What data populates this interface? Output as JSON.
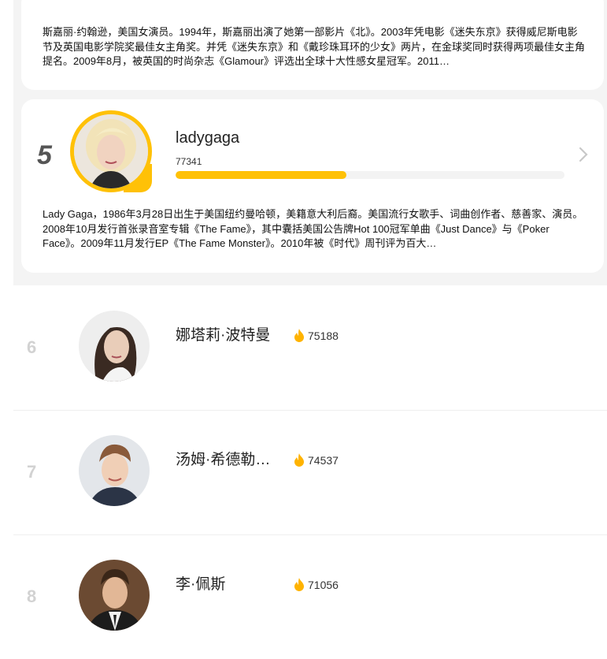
{
  "top_card": {
    "bio": "斯嘉丽·约翰逊，美国女演员。1994年，斯嘉丽出演了她第一部影片《北》。2003年凭电影《迷失东京》获得威尼斯电影节及英国电影学院奖最佳女主角奖。并凭《迷失东京》和《戴珍珠耳环的少女》两片，在金球奖同时获得两项最佳女主角提名。2009年8月，被英国的时尚杂志《Glamour》评选出全球十大性感女星冠军。2011…"
  },
  "featured": {
    "rank": "5",
    "name": "ladygaga",
    "score": "77341",
    "progress": 0.44,
    "bio": "Lady Gaga，1986年3月28日出生于美国纽约曼哈顿，美籍意大利后裔。美国流行女歌手、词曲创作者、慈善家、演员。 2008年10月发行首张录音室专辑《The Fame》，其中囊括美国公告牌Hot 100冠军单曲《Just Dance》与《Poker Face》。2009年11月发行EP《The Fame Monster》。2010年被《时代》周刊评为百大…"
  },
  "list": [
    {
      "rank": "6",
      "name": "娜塔莉·波特曼",
      "score": "75188"
    },
    {
      "rank": "7",
      "name": "汤姆·希德勒…",
      "score": "74537"
    },
    {
      "rank": "8",
      "name": "李·佩斯",
      "score": "71056"
    }
  ],
  "colors": {
    "accent": "#ffc107",
    "rank_gray": "#d2d2d2"
  },
  "icons": {
    "hot": "flame-icon",
    "more": "chevron-right-icon"
  }
}
